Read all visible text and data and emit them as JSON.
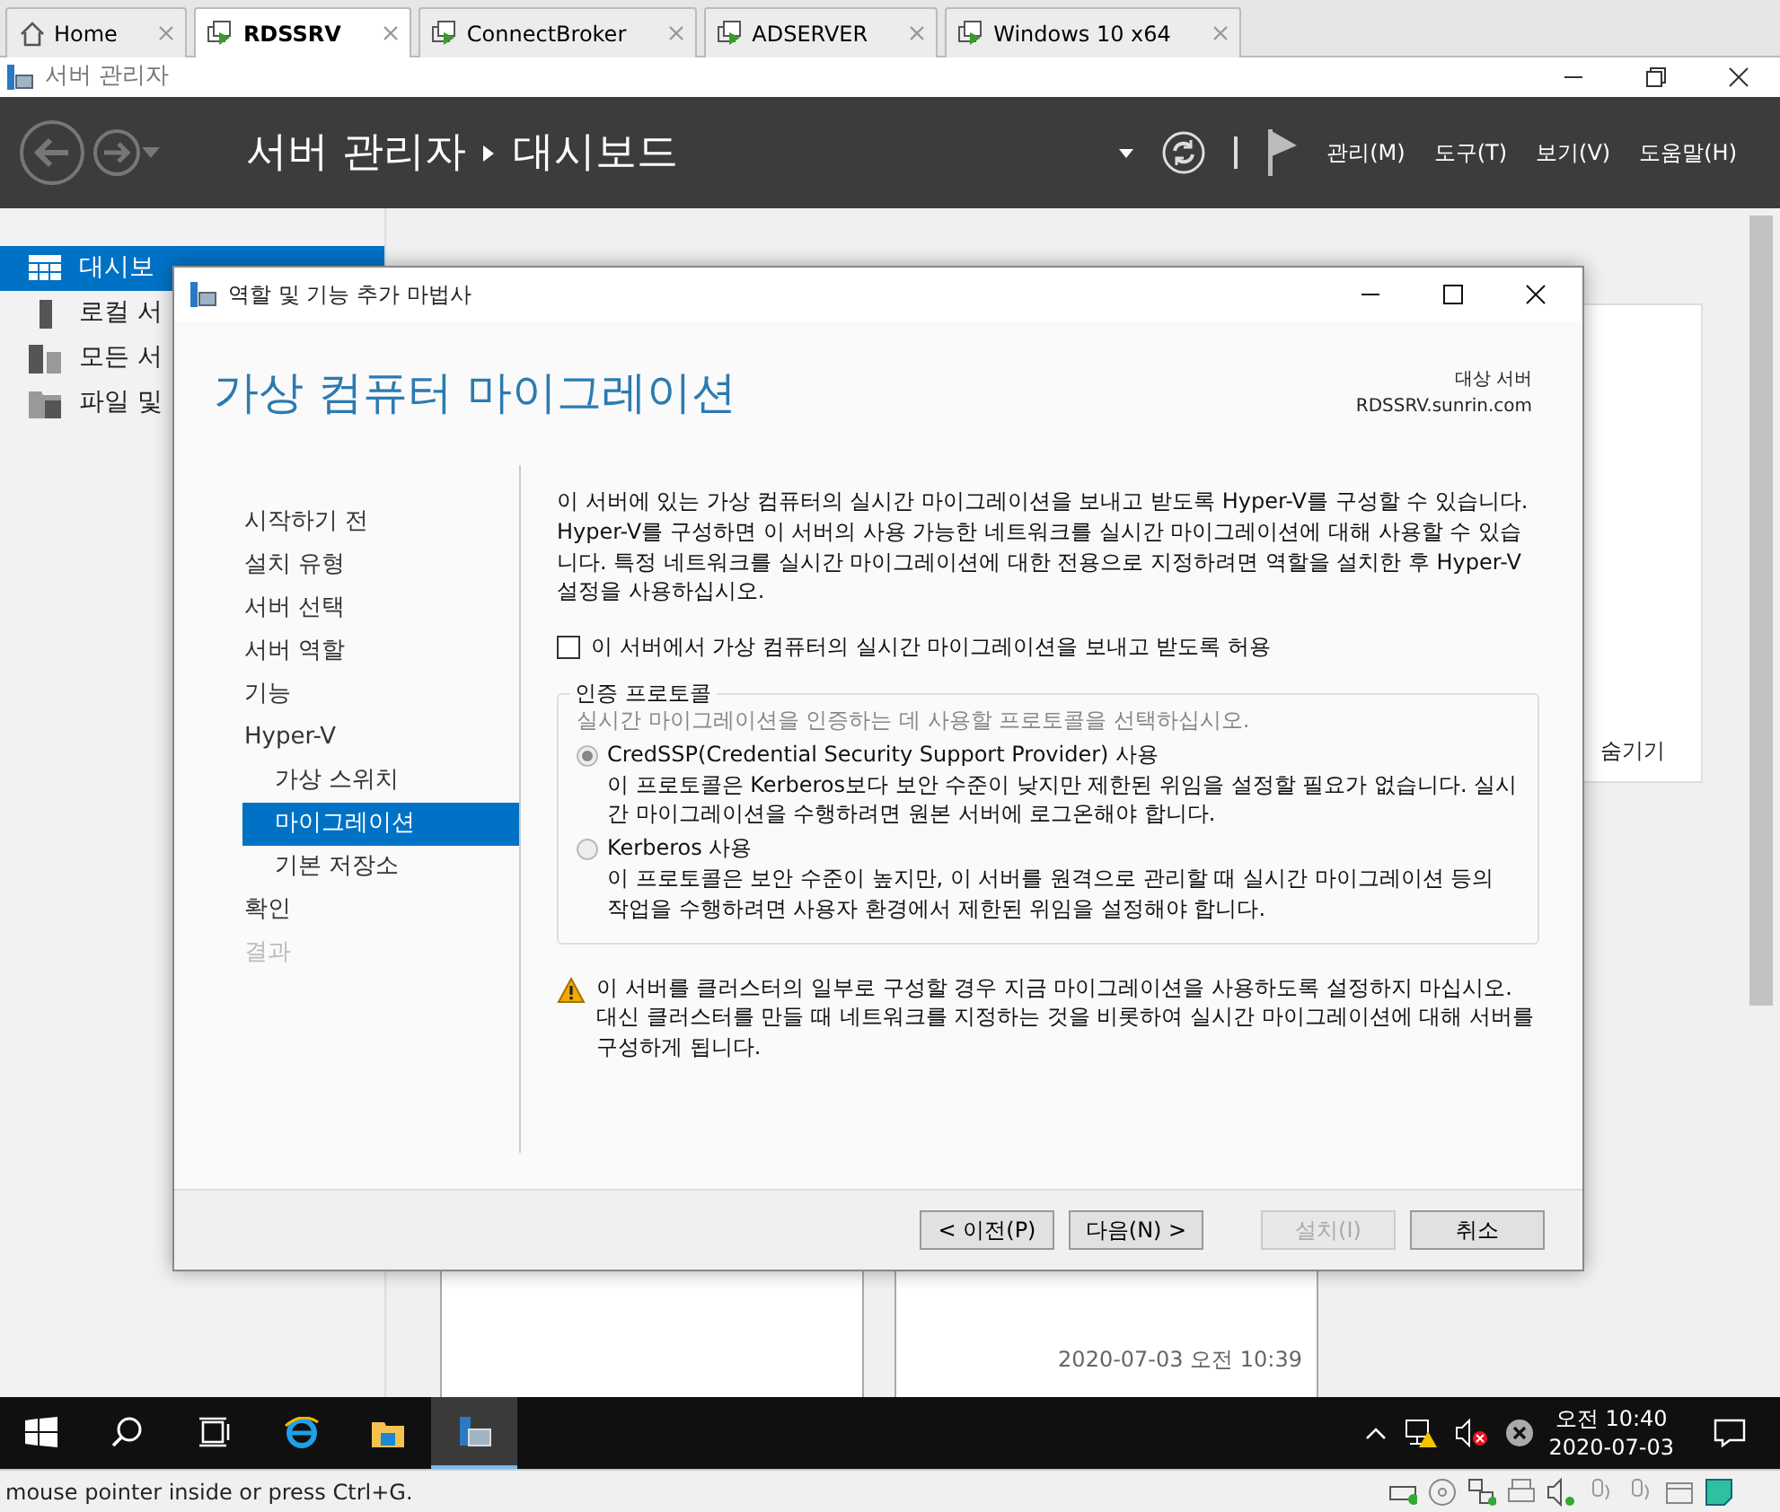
{
  "vm_tabs": [
    {
      "label": "Home",
      "kind": "home",
      "selected": false
    },
    {
      "label": "RDSSRV",
      "kind": "vm",
      "selected": true
    },
    {
      "label": "ConnectBroker",
      "kind": "vm",
      "selected": false
    },
    {
      "label": "ADSERVER",
      "kind": "vm",
      "selected": false
    },
    {
      "label": "Windows 10 x64",
      "kind": "vm",
      "selected": false
    }
  ],
  "app_window": {
    "title": "서버 관리자"
  },
  "header": {
    "breadcrumb": [
      "서버 관리자",
      "대시보드"
    ],
    "menus": [
      "관리(M)",
      "도구(T)",
      "보기(V)",
      "도움말(H)"
    ]
  },
  "sidebar": {
    "items": [
      {
        "label": "대시보",
        "kind": "dashboard",
        "selected": true
      },
      {
        "label": "로컬 서",
        "kind": "server",
        "selected": false
      },
      {
        "label": "모든 서",
        "kind": "servers",
        "selected": false
      },
      {
        "label": "파일 및",
        "kind": "files",
        "selected": false
      }
    ]
  },
  "dashboard": {
    "hide_link": "숨기기",
    "bpa_card": {
      "timestamp": "2020-07-03 오전 10:39"
    }
  },
  "wizard": {
    "title": "역할 및 기능 추가 마법사",
    "page_title": "가상 컴퓨터 마이그레이션",
    "target_label": "대상 서버",
    "target_server": "RDSSRV.sunrin.com",
    "steps": [
      {
        "label": "시작하기 전",
        "selected": false,
        "disabled": false
      },
      {
        "label": "설치 유형",
        "selected": false,
        "disabled": false
      },
      {
        "label": "서버 선택",
        "selected": false,
        "disabled": false
      },
      {
        "label": "서버 역할",
        "selected": false,
        "disabled": false
      },
      {
        "label": "기능",
        "selected": false,
        "disabled": false
      },
      {
        "label": "Hyper-V",
        "selected": false,
        "disabled": false,
        "children": [
          {
            "label": "가상 스위치",
            "selected": false,
            "disabled": false
          },
          {
            "label": "마이그레이션",
            "selected": true,
            "disabled": false
          },
          {
            "label": "기본 저장소",
            "selected": false,
            "disabled": false
          }
        ]
      },
      {
        "label": "확인",
        "selected": false,
        "disabled": false
      },
      {
        "label": "결과",
        "selected": false,
        "disabled": true
      }
    ],
    "description": "이 서버에 있는 가상 컴퓨터의 실시간 마이그레이션을 보내고 받도록 Hyper-V를 구성할 수 있습니다. Hyper-V를 구성하면 이 서버의 사용 가능한 네트워크를 실시간 마이그레이션에 대해 사용할 수 있습니다. 특정 네트워크를 실시간 마이그레이션에 대한 전용으로 지정하려면 역할을 설치한 후 Hyper-V 설정을 사용하십시오.",
    "allow_checkbox": {
      "label": "이 서버에서 가상 컴퓨터의 실시간 마이그레이션을 보내고 받도록 허용",
      "checked": false
    },
    "auth_group": {
      "title": "인증 프로토콜",
      "hint": "실시간 마이그레이션을 인증하는 데 사용할 프로토콜을 선택하십시오.",
      "options": [
        {
          "label": "CredSSP(Credential Security Support Provider) 사용",
          "description": "이 프로토콜은 Kerberos보다 보안 수준이 낮지만 제한된 위임을 설정할 필요가 없습니다. 실시간 마이그레이션을 수행하려면 원본 서버에 로그온해야 합니다.",
          "selected": true
        },
        {
          "label": "Kerberos 사용",
          "description": "이 프로토콜은 보안 수준이 높지만, 이 서버를 원격으로 관리할 때 실시간 마이그레이션 등의 작업을 수행하려면 사용자 환경에서 제한된 위임을 설정해야 합니다.",
          "selected": false
        }
      ]
    },
    "warning": "이 서버를 클러스터의 일부로 구성할 경우 지금 마이그레이션을 사용하도록 설정하지 마십시오. 대신 클러스터를 만들 때 네트워크를 지정하는 것을 비롯하여 실시간 마이그레이션에 대해 서버를 구성하게 됩니다.",
    "buttons": [
      {
        "label": "< 이전(P)",
        "disabled": false
      },
      {
        "label": "다음(N) >",
        "disabled": false
      },
      {
        "label": "설치(I)",
        "disabled": true
      },
      {
        "label": "취소",
        "disabled": false
      }
    ]
  },
  "taskbar": {
    "apps": [
      {
        "kind": "start",
        "selected": false
      },
      {
        "kind": "search",
        "selected": false
      },
      {
        "kind": "taskview",
        "selected": false
      },
      {
        "kind": "browser",
        "selected": false
      },
      {
        "kind": "explorer",
        "selected": false
      },
      {
        "kind": "servermanager",
        "selected": true
      }
    ],
    "time": "오전 10:40",
    "date": "2020-07-03"
  },
  "status_bar": {
    "text": "mouse pointer inside or press Ctrl+G."
  }
}
